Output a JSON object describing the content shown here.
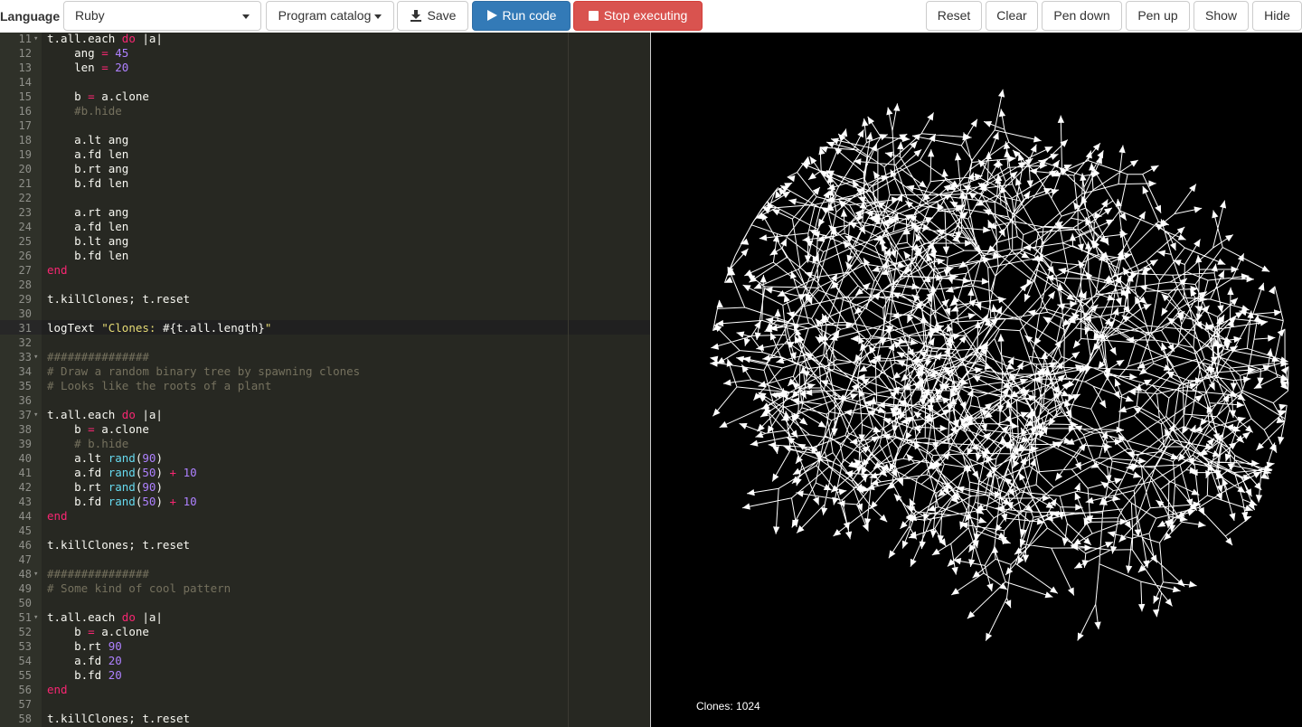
{
  "toolbar": {
    "language_label": "Language",
    "language_value": "Ruby",
    "program_catalog": "Program catalog",
    "save": "Save",
    "run_code": "Run code",
    "stop_executing": "Stop executing",
    "reset": "Reset",
    "clear": "Clear",
    "pen_down": "Pen down",
    "pen_up": "Pen up",
    "show": "Show",
    "hide": "Hide"
  },
  "editor": {
    "theme_colors": {
      "background": "#272822",
      "keyword": "#f92672",
      "number": "#ae81ff",
      "string": "#e6db74",
      "comment": "#75715e",
      "function": "#66d9ef"
    },
    "active_line": 31,
    "lines": [
      {
        "n": "11",
        "fold": true,
        "t": [
          [
            "t.all.each ",
            "p"
          ],
          [
            "do",
            "kw"
          ],
          [
            " |a|",
            "p"
          ]
        ]
      },
      {
        "n": "12",
        "t": [
          [
            "    ang ",
            "p"
          ],
          [
            "=",
            "op"
          ],
          [
            " ",
            "p"
          ],
          [
            "45",
            "num"
          ]
        ]
      },
      {
        "n": "13",
        "t": [
          [
            "    len ",
            "p"
          ],
          [
            "=",
            "op"
          ],
          [
            " ",
            "p"
          ],
          [
            "20",
            "num"
          ]
        ]
      },
      {
        "n": "14",
        "t": []
      },
      {
        "n": "15",
        "t": [
          [
            "    b ",
            "p"
          ],
          [
            "=",
            "op"
          ],
          [
            " a.clone",
            "p"
          ]
        ]
      },
      {
        "n": "16",
        "t": [
          [
            "    #b.hide",
            "cm"
          ]
        ]
      },
      {
        "n": "17",
        "t": []
      },
      {
        "n": "18",
        "t": [
          [
            "    a.lt ang",
            "p"
          ]
        ]
      },
      {
        "n": "19",
        "t": [
          [
            "    a.fd len",
            "p"
          ]
        ]
      },
      {
        "n": "20",
        "t": [
          [
            "    b.rt ang",
            "p"
          ]
        ]
      },
      {
        "n": "21",
        "t": [
          [
            "    b.fd len",
            "p"
          ]
        ]
      },
      {
        "n": "22",
        "t": []
      },
      {
        "n": "23",
        "t": [
          [
            "    a.rt ang",
            "p"
          ]
        ]
      },
      {
        "n": "24",
        "t": [
          [
            "    a.fd len",
            "p"
          ]
        ]
      },
      {
        "n": "25",
        "t": [
          [
            "    b.lt ang",
            "p"
          ]
        ]
      },
      {
        "n": "26",
        "t": [
          [
            "    b.fd len",
            "p"
          ]
        ]
      },
      {
        "n": "27",
        "t": [
          [
            "end",
            "kw"
          ]
        ]
      },
      {
        "n": "28",
        "t": []
      },
      {
        "n": "29",
        "t": [
          [
            "t.killClones; t.reset",
            "p"
          ]
        ]
      },
      {
        "n": "30",
        "t": []
      },
      {
        "n": "31",
        "t": [
          [
            "logText ",
            "p"
          ],
          [
            "\"Clones: ",
            "str"
          ],
          [
            "#{t.all.length}",
            "p"
          ],
          [
            "\"",
            "str"
          ]
        ]
      },
      {
        "n": "32",
        "t": []
      },
      {
        "n": "33",
        "fold": true,
        "t": [
          [
            "###############",
            "cm"
          ]
        ]
      },
      {
        "n": "34",
        "t": [
          [
            "# Draw a random binary tree by spawning clones",
            "cm"
          ]
        ]
      },
      {
        "n": "35",
        "t": [
          [
            "# Looks like the roots of a plant",
            "cm"
          ]
        ]
      },
      {
        "n": "36",
        "t": []
      },
      {
        "n": "37",
        "fold": true,
        "t": [
          [
            "t.all.each ",
            "p"
          ],
          [
            "do",
            "kw"
          ],
          [
            " |a|",
            "p"
          ]
        ]
      },
      {
        "n": "38",
        "t": [
          [
            "    b ",
            "p"
          ],
          [
            "=",
            "op"
          ],
          [
            " a.clone",
            "p"
          ]
        ]
      },
      {
        "n": "39",
        "t": [
          [
            "    # b.hide",
            "cm"
          ]
        ]
      },
      {
        "n": "40",
        "t": [
          [
            "    a.lt ",
            "p"
          ],
          [
            "rand",
            "fn"
          ],
          [
            "(",
            "p"
          ],
          [
            "90",
            "num"
          ],
          [
            ")",
            "p"
          ]
        ]
      },
      {
        "n": "41",
        "t": [
          [
            "    a.fd ",
            "p"
          ],
          [
            "rand",
            "fn"
          ],
          [
            "(",
            "p"
          ],
          [
            "50",
            "num"
          ],
          [
            ") ",
            "p"
          ],
          [
            "+",
            "op"
          ],
          [
            " ",
            "p"
          ],
          [
            "10",
            "num"
          ]
        ]
      },
      {
        "n": "42",
        "t": [
          [
            "    b.rt ",
            "p"
          ],
          [
            "rand",
            "fn"
          ],
          [
            "(",
            "p"
          ],
          [
            "90",
            "num"
          ],
          [
            ")",
            "p"
          ]
        ]
      },
      {
        "n": "43",
        "t": [
          [
            "    b.fd ",
            "p"
          ],
          [
            "rand",
            "fn"
          ],
          [
            "(",
            "p"
          ],
          [
            "50",
            "num"
          ],
          [
            ") ",
            "p"
          ],
          [
            "+",
            "op"
          ],
          [
            " ",
            "p"
          ],
          [
            "10",
            "num"
          ]
        ]
      },
      {
        "n": "44",
        "t": [
          [
            "end",
            "kw"
          ]
        ]
      },
      {
        "n": "45",
        "t": []
      },
      {
        "n": "46",
        "t": [
          [
            "t.killClones; t.reset",
            "p"
          ]
        ]
      },
      {
        "n": "47",
        "t": []
      },
      {
        "n": "48",
        "fold": true,
        "t": [
          [
            "###############",
            "cm"
          ]
        ]
      },
      {
        "n": "49",
        "t": [
          [
            "# Some kind of cool pattern",
            "cm"
          ]
        ]
      },
      {
        "n": "50",
        "t": []
      },
      {
        "n": "51",
        "fold": true,
        "t": [
          [
            "t.all.each ",
            "p"
          ],
          [
            "do",
            "kw"
          ],
          [
            " |a|",
            "p"
          ]
        ]
      },
      {
        "n": "52",
        "t": [
          [
            "    b ",
            "p"
          ],
          [
            "=",
            "op"
          ],
          [
            " a.clone",
            "p"
          ]
        ]
      },
      {
        "n": "53",
        "t": [
          [
            "    b.rt ",
            "p"
          ],
          [
            "90",
            "num"
          ]
        ]
      },
      {
        "n": "54",
        "t": [
          [
            "    a.fd ",
            "p"
          ],
          [
            "20",
            "num"
          ]
        ]
      },
      {
        "n": "55",
        "t": [
          [
            "    b.fd ",
            "p"
          ],
          [
            "20",
            "num"
          ]
        ]
      },
      {
        "n": "56",
        "t": [
          [
            "end",
            "kw"
          ]
        ]
      },
      {
        "n": "57",
        "t": []
      },
      {
        "n": "58",
        "t": [
          [
            "t.killClones; t.reset",
            "p"
          ]
        ]
      }
    ]
  },
  "canvas": {
    "background": "#000000",
    "stroke": "#ffffff",
    "log_text": "Clones: 1024"
  }
}
